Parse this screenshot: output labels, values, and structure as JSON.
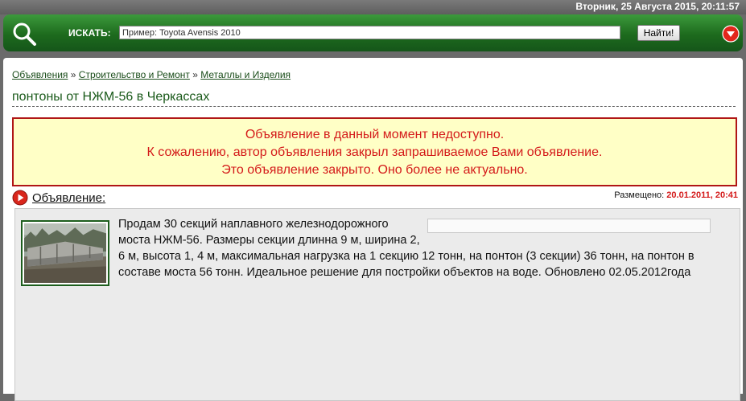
{
  "date": "Вторник, 25 Августа 2015, 20:11:57",
  "search": {
    "label": "ИСКАТЬ:",
    "placeholder": "Пример: Toyota Avensis 2010",
    "button": "Найти!"
  },
  "breadcrumb": {
    "items": [
      "Объявления",
      "Строительство и Ремонт",
      "Металлы и Изделия"
    ],
    "separator": "»"
  },
  "title": "понтоны от НЖМ-56 в Черкассах",
  "notice": {
    "line1": "Объявление в данный момент недоступно.",
    "line2": "К сожалению, автор объявления закрыл запрашиваемое Вами объявление.",
    "line3": "Это объявление закрыто. Оно более не актуально."
  },
  "ad": {
    "heading": "Объявление:",
    "posted_label": "Размещено:",
    "posted_date": "20.01.2011, 20:41",
    "text": "Продам 30 секций наплавного железнодорожного моста НЖМ-56. Размеры секции длинна 9 м, ширина 2, 6 м, высота 1, 4 м, максимальная нагрузка на 1 секцию 12 тонн, на понтон (3 секции) 36 тонн, на понтон в составе моста 56 тонн. Идеальное решение для постройки объектов на воде. Обновлено 02.05.2012года"
  },
  "colors": {
    "header_green": "#1d6a1d",
    "notice_bg": "#ffffc6",
    "notice_text": "#d41a1a",
    "accent_red": "#d41a1a"
  },
  "icons": {
    "search": "magnifier-icon",
    "menu": "chevron-down-icon",
    "section": "play-icon"
  }
}
